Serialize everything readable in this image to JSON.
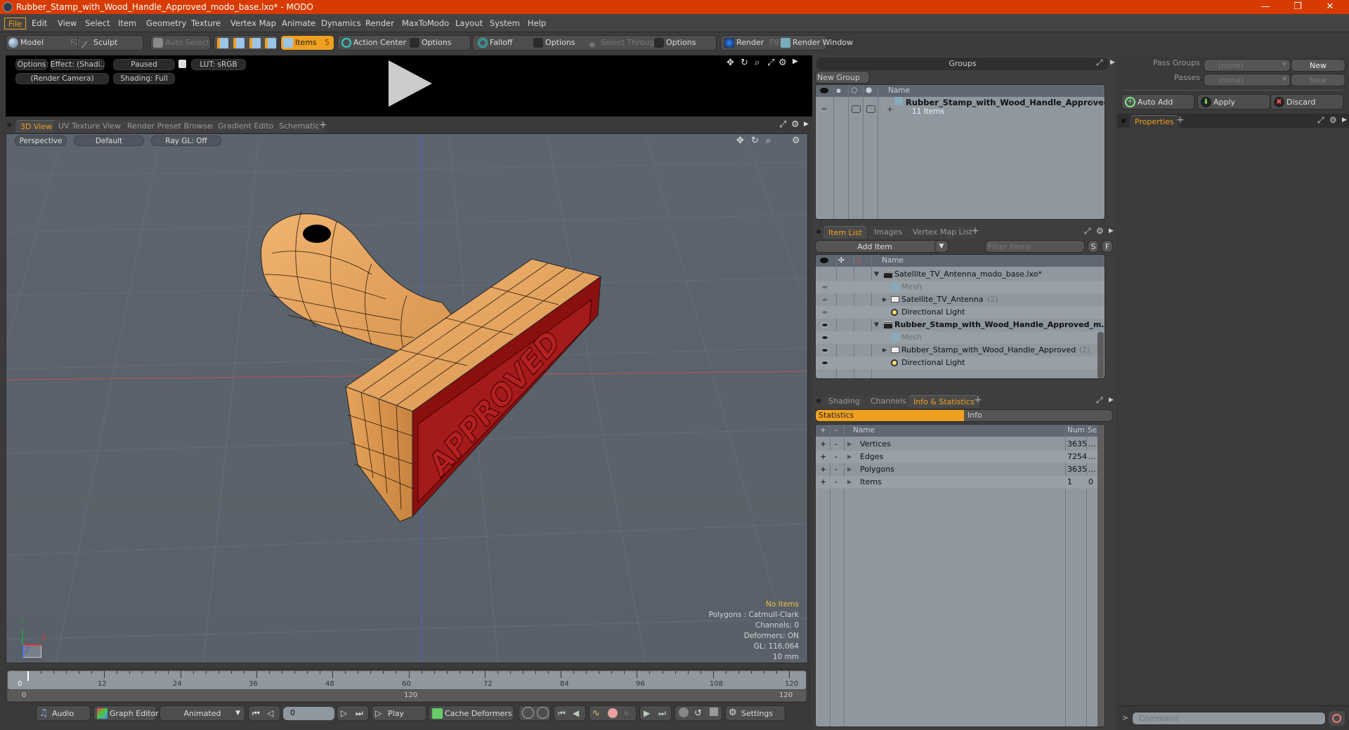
{
  "window": {
    "title": "Rubber_Stamp_with_Wood_Handle_Approved_modo_base.lxo* - MODO",
    "controls": {
      "minimize": "—",
      "restore": "❐",
      "close": "✕"
    }
  },
  "menu": [
    "File",
    "Edit",
    "View",
    "Select",
    "Item",
    "Geometry",
    "Texture",
    "Vertex Map",
    "Animate",
    "Dynamics",
    "Render",
    "MaxToModo",
    "Layout",
    "System",
    "Help"
  ],
  "toolbar": {
    "model": "Model",
    "model_key": "F2",
    "sculpt": "Sculpt",
    "auto_select": "Auto Select",
    "items": "Items",
    "items_count": "5",
    "action_center": "Action Center",
    "options1": "Options",
    "falloff": "Falloff",
    "options2": "Options",
    "select_through": "Select Through",
    "options3": "Options",
    "render": "Render",
    "render_key": "F9",
    "render_window": "Render Window"
  },
  "render_preview": {
    "options": "Options",
    "effect": "Effect: (Shadi...",
    "paused": "Paused",
    "lut": "LUT: sRGB",
    "camera": "(Render Camera)",
    "shading": "Shading: Full"
  },
  "view_tabs": [
    "3D View",
    "UV Texture View",
    "Render Preset Browser",
    "Gradient Editor",
    "Schematic"
  ],
  "viewport": {
    "projection": "Perspective",
    "style": "Default",
    "raygl": "Ray GL: Off",
    "hud": {
      "selection": "No Items",
      "polygons": "Polygons : Catmull-Clark",
      "channels": "Channels: 0",
      "deformers": "Deformers: ON",
      "gl": "GL: 116,064",
      "unit": "10 mm"
    },
    "axes": {
      "x": "X",
      "y": "Y",
      "z": "Z"
    },
    "stamp_text": "APPROVED",
    "colors": {
      "wood": "#e8a55a",
      "rubber": "#a01818",
      "grid_red": "#c0504d",
      "grid_blue": "#5060d0"
    }
  },
  "timeline": {
    "ticks": [
      "0",
      "12",
      "24",
      "36",
      "48",
      "60",
      "72",
      "84",
      "96",
      "108",
      "120"
    ],
    "range_start": "0",
    "range_mid": "120",
    "range_end": "120"
  },
  "bottombar": {
    "audio": "Audio",
    "graph_editor": "Graph Editor",
    "animated": "Animated",
    "frame": "0",
    "play": "Play",
    "cache_deformers": "Cache Deformers",
    "settings": "Settings"
  },
  "groups": {
    "title": "Groups",
    "new_group": "New Group",
    "col_name": "Name",
    "row_name": "Rubber_Stamp_with_Wood_Handle_Approved",
    "row_suffix": "(...",
    "row_sub": "11 Items"
  },
  "item_list": {
    "tabs": [
      "Item List",
      "Images",
      "Vertex Map List"
    ],
    "add_item": "Add Item",
    "filter_placeholder": "Filter Items",
    "s_btn": "S",
    "f_btn": "F",
    "col_name": "Name",
    "rows": [
      {
        "label": "Satellite_TV_Antenna_modo_base.lxo*",
        "type": "scene",
        "level": 0,
        "bold": false
      },
      {
        "label": "Mesh",
        "type": "mesh",
        "level": 1,
        "dim": true
      },
      {
        "label": "Satellite_TV_Antenna",
        "count": "(2)",
        "type": "group",
        "level": 1
      },
      {
        "label": "Directional Light",
        "type": "light",
        "level": 1
      },
      {
        "label": "Rubber_Stamp_with_Wood_Handle_Approved_m...",
        "type": "scene",
        "level": 0,
        "bold": true
      },
      {
        "label": "Mesh",
        "type": "mesh",
        "level": 1,
        "dim": true
      },
      {
        "label": "Rubber_Stamp_with_Wood_Handle_Approved",
        "count": "(2)",
        "type": "group",
        "level": 1
      },
      {
        "label": "Directional Light",
        "type": "light",
        "level": 1
      }
    ]
  },
  "info_panel": {
    "tabs": [
      "Shading",
      "Channels",
      "Info & Statistics"
    ],
    "sub_tabs": [
      "Statistics",
      "Info"
    ],
    "cols": {
      "plus": "+",
      "minus": "-",
      "name": "Name",
      "num": "Num",
      "sel": "Sel"
    },
    "rows": [
      {
        "name": "Vertices",
        "num": "3635",
        "sel": "..."
      },
      {
        "name": "Edges",
        "num": "7254",
        "sel": "..."
      },
      {
        "name": "Polygons",
        "num": "3635",
        "sel": "..."
      },
      {
        "name": "Items",
        "num": "1",
        "sel": "0"
      }
    ]
  },
  "passes": {
    "pass_groups_label": "Pass Groups",
    "pass_groups_value": "(none)",
    "passes_label": "Passes",
    "passes_value": "(none)",
    "new1": "New",
    "new2": "New",
    "auto_add": "Auto Add",
    "apply": "Apply",
    "discard": "Discard"
  },
  "properties": {
    "tab": "Properties"
  },
  "command": {
    "prompt": ">",
    "placeholder": "Command"
  }
}
